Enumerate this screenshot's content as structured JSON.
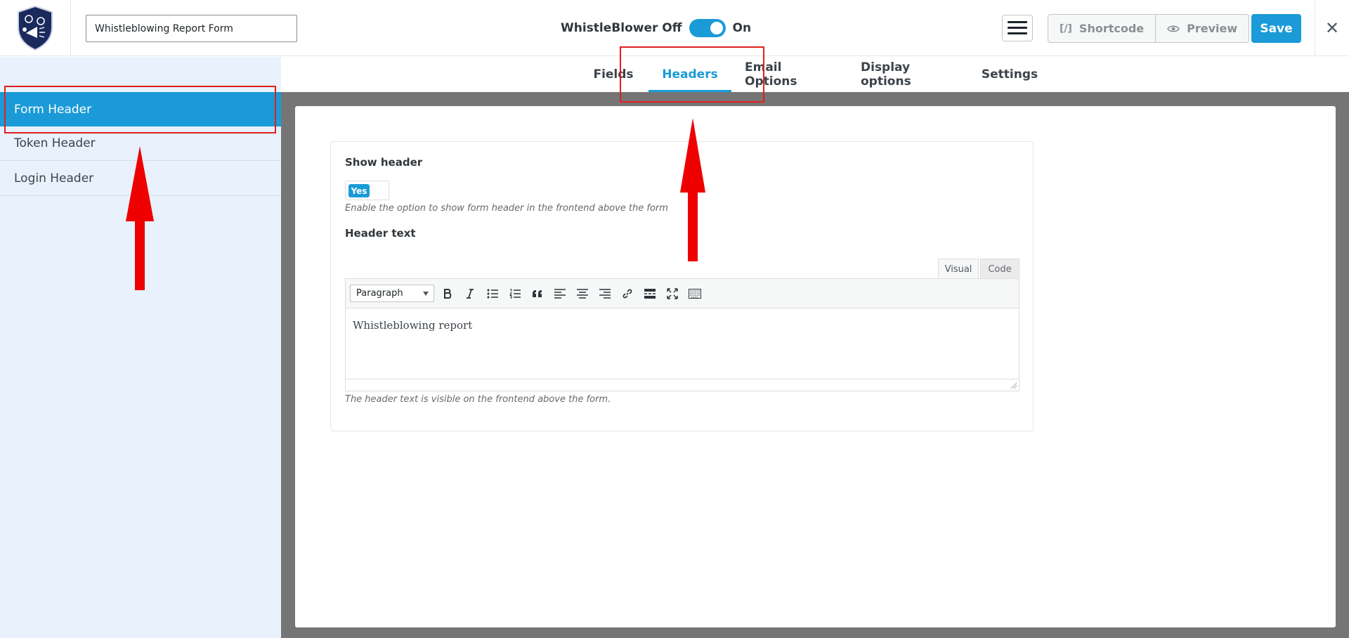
{
  "topbar": {
    "logo_label": "logo",
    "form_title_value": "Whistleblowing Report Form",
    "whistleblower_off_label": "WhistleBlower Off",
    "whistleblower_on_label": "On",
    "shortcode_label": "Shortcode",
    "shortcode_icon_text": "[/]",
    "preview_label": "Preview",
    "save_label": "Save",
    "close_glyph": "✕"
  },
  "sidebar": {
    "items": [
      {
        "label": "Form Header",
        "active": true
      },
      {
        "label": "Token Header",
        "active": false
      },
      {
        "label": "Login Header",
        "active": false
      }
    ]
  },
  "tabs": [
    {
      "label": "Fields",
      "active": false
    },
    {
      "label": "Headers",
      "active": true
    },
    {
      "label": "Email Options",
      "active": false
    },
    {
      "label": "Display options",
      "active": false
    },
    {
      "label": "Settings",
      "active": false
    }
  ],
  "settings": {
    "show_header_label": "Show header",
    "show_header_value": "Yes",
    "show_header_hint": "Enable the option to show form header in the frontend above the form",
    "header_text_label": "Header text",
    "header_text_hint": "The header text is visible on the frontend above the form."
  },
  "editor": {
    "visual_tab": "Visual",
    "code_tab": "Code",
    "format_value": "Paragraph",
    "content": "Whistleblowing report",
    "toolbar_icons": [
      "bold-icon",
      "italic-icon",
      "bullet-list-icon",
      "numbered-list-icon",
      "blockquote-icon",
      "align-left-icon",
      "align-center-icon",
      "align-right-icon",
      "link-icon",
      "read-more-icon",
      "fullscreen-icon",
      "toolbar-toggle-icon"
    ]
  },
  "colors": {
    "accent": "#1a9bd7",
    "annotation": "#e02020",
    "sidebar_bg": "#e8f1fc",
    "canvas_bg": "#757575"
  }
}
